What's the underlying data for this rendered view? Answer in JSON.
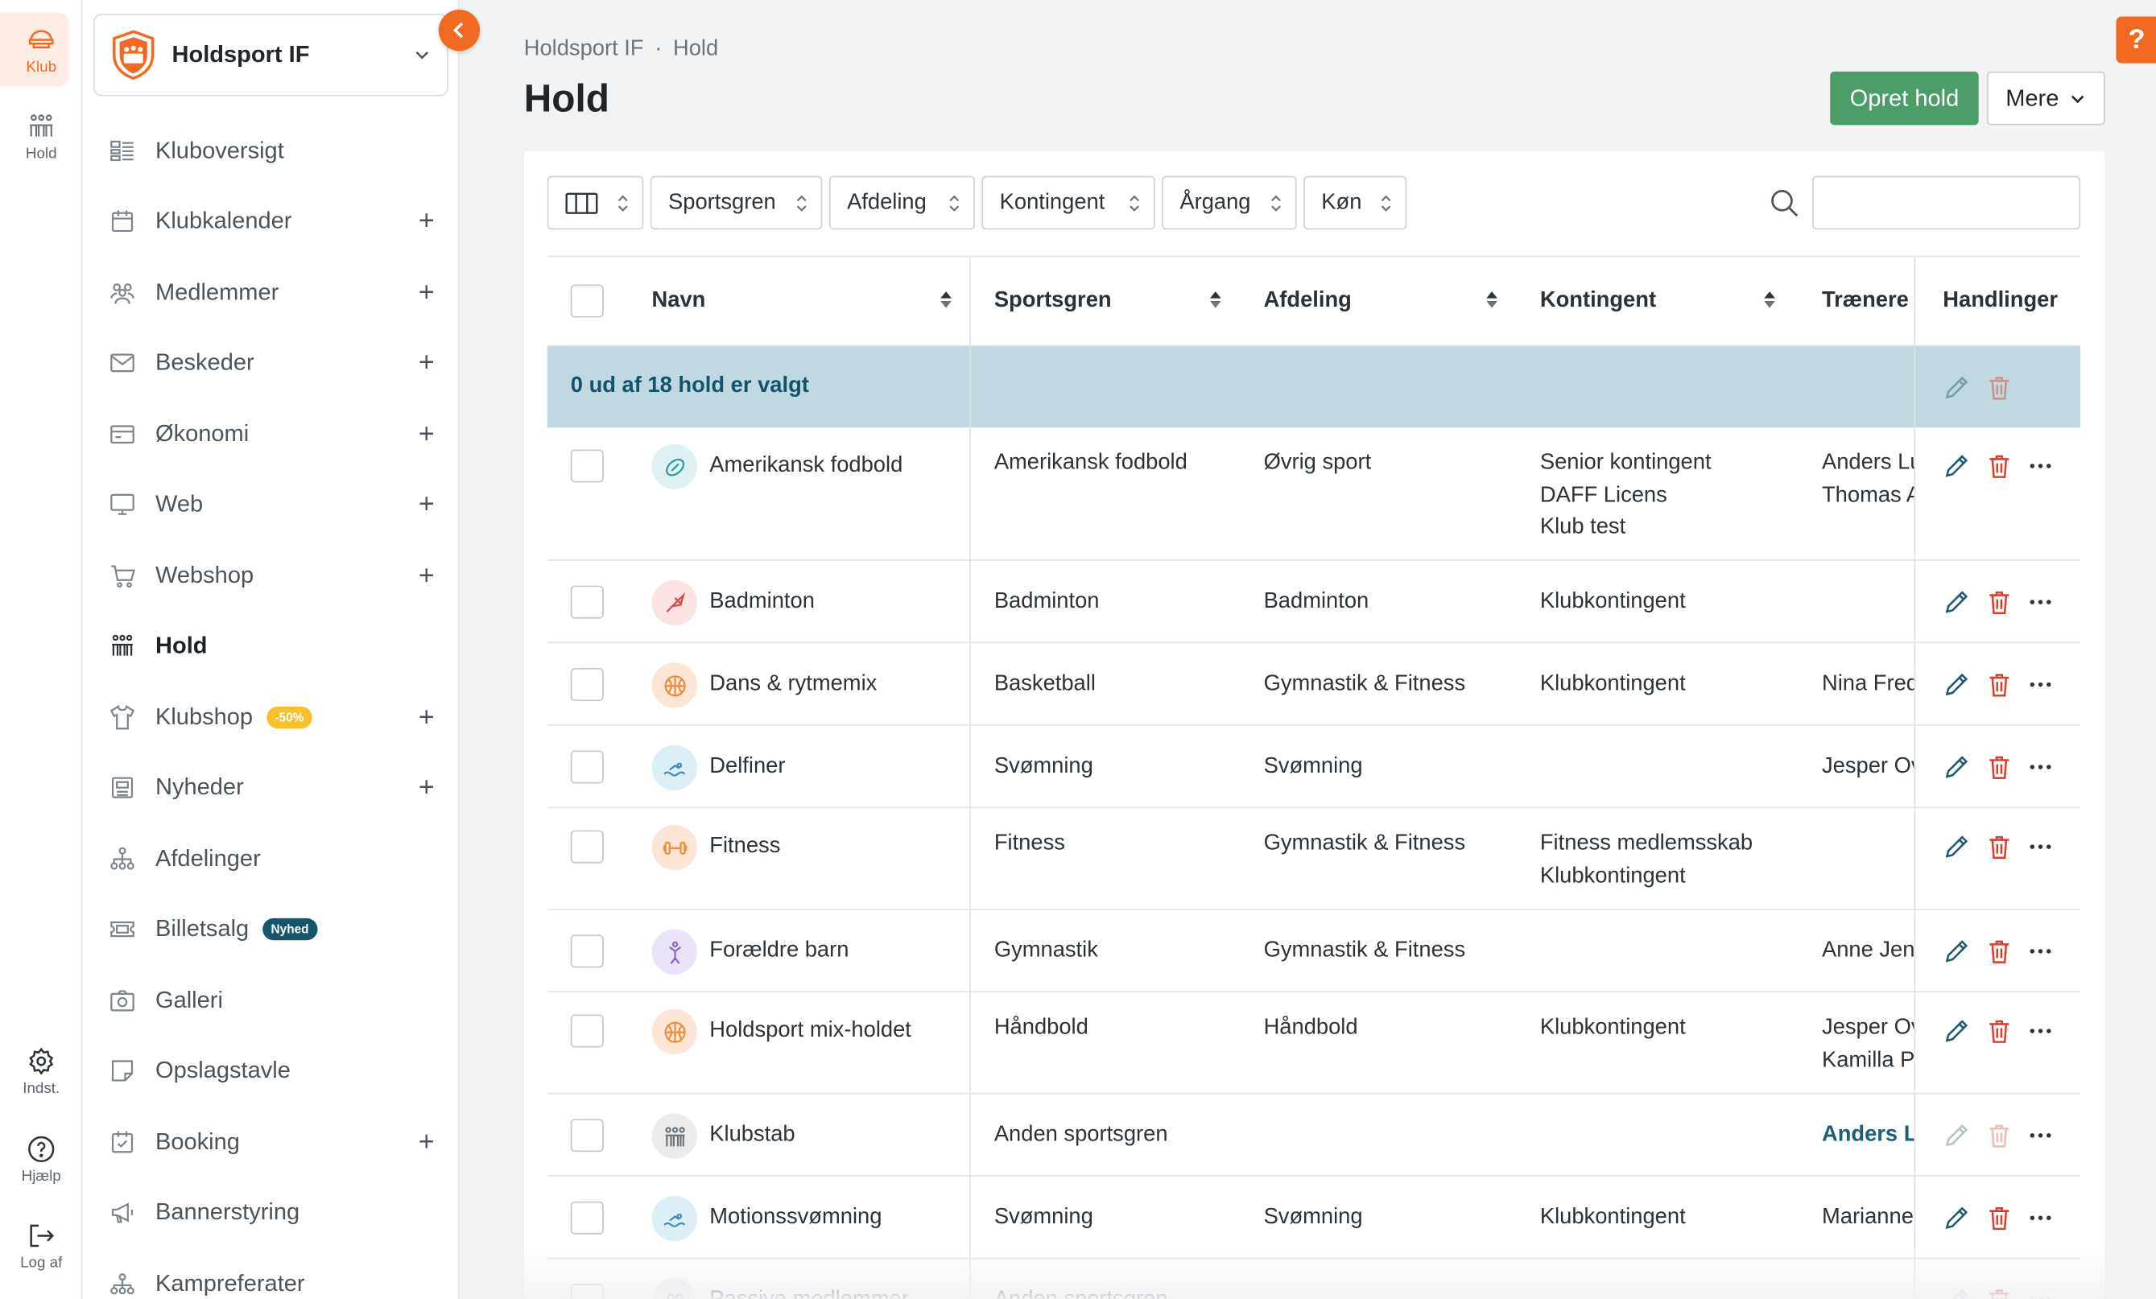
{
  "rail": {
    "items": [
      {
        "label": "Klub",
        "icon": "club-icon",
        "active": true
      },
      {
        "label": "Hold",
        "icon": "team-icon",
        "active": false
      }
    ],
    "bottom": [
      {
        "label": "Indst.",
        "icon": "gear-icon"
      },
      {
        "label": "Hjælp",
        "icon": "help-icon"
      },
      {
        "label": "Log af",
        "icon": "logout-icon"
      }
    ]
  },
  "sidebar": {
    "club_name": "Holdsport IF",
    "items": [
      {
        "label": "Kluboversigt",
        "icon": "dashboard-icon",
        "plus": false
      },
      {
        "label": "Klubkalender",
        "icon": "calendar-icon",
        "plus": true
      },
      {
        "label": "Medlemmer",
        "icon": "members-icon",
        "plus": true
      },
      {
        "label": "Beskeder",
        "icon": "mail-icon",
        "plus": true
      },
      {
        "label": "Økonomi",
        "icon": "wallet-icon",
        "plus": true
      },
      {
        "label": "Web",
        "icon": "monitor-icon",
        "plus": true
      },
      {
        "label": "Webshop",
        "icon": "cart-icon",
        "plus": true
      },
      {
        "label": "Hold",
        "icon": "team-icon",
        "plus": false,
        "active": true
      },
      {
        "label": "Klubshop",
        "icon": "shirt-icon",
        "plus": true,
        "badge": "-50%"
      },
      {
        "label": "Nyheder",
        "icon": "news-icon",
        "plus": true
      },
      {
        "label": "Afdelinger",
        "icon": "hierarchy-icon",
        "plus": false
      },
      {
        "label": "Billetsalg",
        "icon": "ticket-icon",
        "plus": false,
        "badge_new": "Nyhed"
      },
      {
        "label": "Galleri",
        "icon": "camera-icon",
        "plus": false
      },
      {
        "label": "Opslagstavle",
        "icon": "note-icon",
        "plus": false
      },
      {
        "label": "Booking",
        "icon": "booking-icon",
        "plus": true
      },
      {
        "label": "Bannerstyring",
        "icon": "megaphone-icon",
        "plus": false
      },
      {
        "label": "Kampreferater",
        "icon": "match-icon",
        "plus": false
      }
    ]
  },
  "header": {
    "breadcrumb": [
      "Holdsport IF",
      "Hold"
    ],
    "breadcrumb_sep": "·",
    "title": "Hold",
    "create_label": "Opret hold",
    "more_label": "Mere",
    "help_label": "?"
  },
  "filters": [
    "Sportsgren",
    "Afdeling",
    "Kontingent",
    "Årgang",
    "Køn"
  ],
  "search": {
    "placeholder": "",
    "value": ""
  },
  "table": {
    "columns": [
      "Navn",
      "Sportsgren",
      "Afdeling",
      "Kontingent",
      "Trænere",
      "Handlinger"
    ],
    "selection_text": "0 ud af 18 hold er valgt",
    "rows": [
      {
        "name": "Amerikansk fodbold",
        "icon": "football-icon",
        "sport": "Amerikansk fodbold",
        "dept": "Øvrig sport",
        "fee": [
          "Senior kontingent",
          "DAFF Licens",
          "Klub test"
        ],
        "coaches": [
          "Anders Lu",
          "Thomas A"
        ]
      },
      {
        "name": "Badminton",
        "icon": "shuttlecock-icon",
        "sport": "Badminton",
        "dept": "Badminton",
        "fee": [
          "Klubkontingent"
        ],
        "coaches": [
          ""
        ]
      },
      {
        "name": "Dans & rytmemix",
        "icon": "basketball-icon",
        "sport": "Basketball",
        "dept": "Gymnastik & Fitness",
        "fee": [
          "Klubkontingent"
        ],
        "coaches": [
          "Nina Fred"
        ]
      },
      {
        "name": "Delfiner",
        "icon": "swimming-icon",
        "sport": "Svømning",
        "dept": "Svømning",
        "fee": [
          ""
        ],
        "coaches": [
          "Jesper Ov"
        ]
      },
      {
        "name": "Fitness",
        "icon": "dumbbell-icon",
        "sport": "Fitness",
        "dept": "Gymnastik & Fitness",
        "fee": [
          "Fitness medlemsskab",
          "Klubkontingent"
        ],
        "coaches": [
          ""
        ]
      },
      {
        "name": "Forældre barn",
        "icon": "gymnast-icon",
        "sport": "Gymnastik",
        "dept": "Gymnastik & Fitness",
        "fee": [
          ""
        ],
        "coaches": [
          "Anne Jens"
        ]
      },
      {
        "name": "Holdsport mix-holdet",
        "icon": "handball-icon",
        "sport": "Håndbold",
        "dept": "Håndbold",
        "fee": [
          "Klubkontingent"
        ],
        "coaches": [
          "Jesper Ov",
          "Kamilla Pe"
        ]
      },
      {
        "name": "Klubstab",
        "icon": "staff-icon",
        "sport": "Anden sportsgren",
        "dept": "",
        "fee": [
          ""
        ],
        "coaches": [
          "Anders Lu"
        ]
      },
      {
        "name": "Motionssvømning",
        "icon": "swimming-icon",
        "sport": "Svømning",
        "dept": "Svømning",
        "fee": [
          "Klubkontingent"
        ],
        "coaches": [
          "Marianne"
        ]
      },
      {
        "name": "Passive medlemmer",
        "icon": "people-icon",
        "sport": "Anden sportsgren",
        "dept": "",
        "fee": [
          ""
        ],
        "coaches": [
          ""
        ]
      }
    ]
  },
  "colors": {
    "accent": "#f26a22",
    "primary_button": "#4b9e68",
    "selection_bar": "#c0d8df",
    "selection_text": "#11536a",
    "delete": "#d9412f",
    "edit": "#1f5a74"
  }
}
